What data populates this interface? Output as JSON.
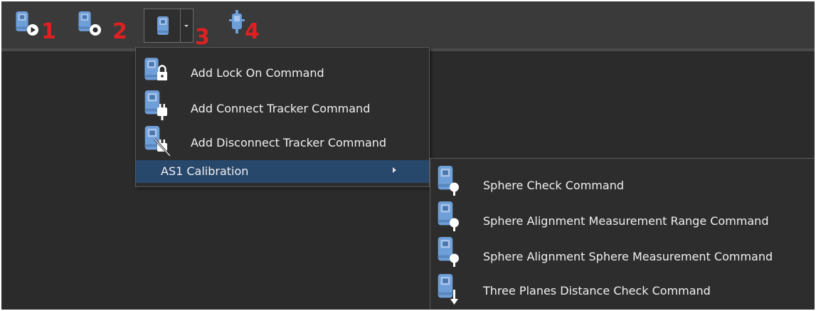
{
  "toolbar": {
    "tools": [
      {
        "number": "1",
        "icon": "tracker-play-icon"
      },
      {
        "number": "2",
        "icon": "tracker-stop-icon"
      },
      {
        "number": "3",
        "icon": "tracker-icon"
      },
      {
        "number": "4",
        "icon": "tracker-probe-icon"
      }
    ]
  },
  "menu": {
    "items": [
      {
        "label": "Add Lock On Command",
        "icon": "tracker-lock-icon"
      },
      {
        "label": "Add Connect Tracker Command",
        "icon": "tracker-plug-icon"
      },
      {
        "label": "Add Disconnect Tracker Command",
        "icon": "tracker-unplug-icon"
      },
      {
        "label": "AS1 Calibration",
        "has_submenu": true
      }
    ]
  },
  "submenu": {
    "items": [
      {
        "label": "Sphere Check Command",
        "icon": "tracker-sphere-icon"
      },
      {
        "label": "Sphere Alignment Measurement Range Command",
        "icon": "tracker-sphere-icon"
      },
      {
        "label": "Sphere Alignment Sphere Measurement Command",
        "icon": "tracker-sphere-icon"
      },
      {
        "label": "Three Planes Distance Check Command",
        "icon": "tracker-arrow-down-icon"
      }
    ]
  },
  "colors": {
    "background": "#2b2b2b",
    "toolbar": "#3a3a3a",
    "highlight": "#27476b",
    "number_red": "#e02020",
    "icon_blue": "#6f9fd8"
  }
}
